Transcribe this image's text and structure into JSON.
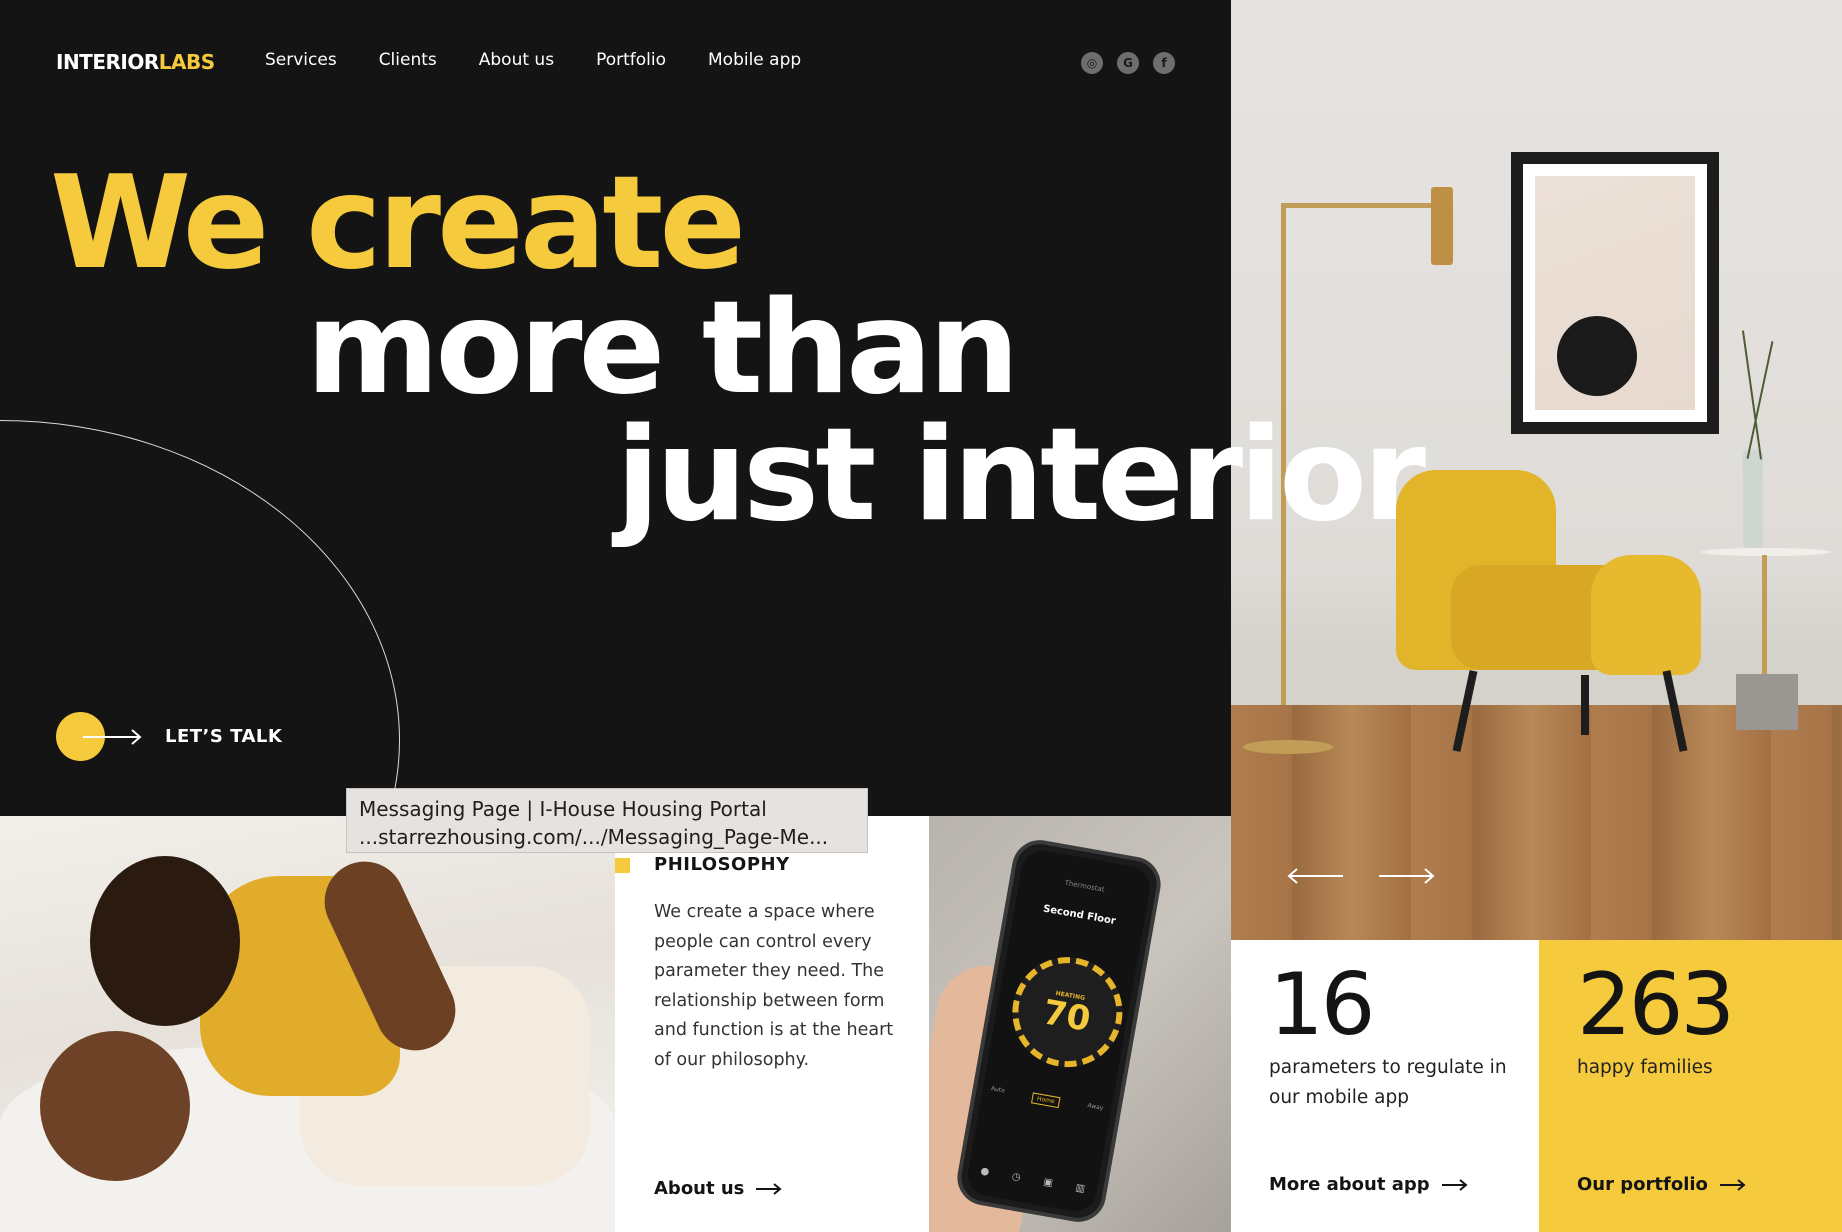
{
  "brand": {
    "part1": "INTERIOR",
    "part2": "LABS",
    "accent": "#f5ca3c",
    "dark": "#141414"
  },
  "nav": {
    "items": [
      "Services",
      "Clients",
      "About us",
      "Portfolio",
      "Mobile app"
    ]
  },
  "social": {
    "icons": [
      "instagram-icon",
      "google-icon",
      "facebook-icon"
    ],
    "glyphs": [
      "◎",
      "G",
      "f"
    ]
  },
  "hero": {
    "line1": "We create",
    "line2": "more than",
    "line3": "just interior",
    "cta_label": "LET’S TALK"
  },
  "philosophy": {
    "title": "PHILOSOPHY",
    "text": "We create a space where people can control every parameter they need. The relationship between form and function is at the heart of our philosophy.",
    "link": "About us"
  },
  "phone": {
    "screen_title": "Thermostat",
    "floor": "Second Floor",
    "mode_label": "HEATING",
    "temperature": "70",
    "modes": [
      "Auto",
      "Home",
      "Away"
    ]
  },
  "stats": [
    {
      "number": "16",
      "text": "parameters to regulate in our mobile app",
      "link": "More about app"
    },
    {
      "number": "263",
      "text": "happy families",
      "link": "Our portfolio"
    }
  ],
  "tooltip": {
    "title": "Messaging Page | I-House Housing Portal",
    "url": "...starrezhousing.com/.../Messaging_Page-Me..."
  }
}
